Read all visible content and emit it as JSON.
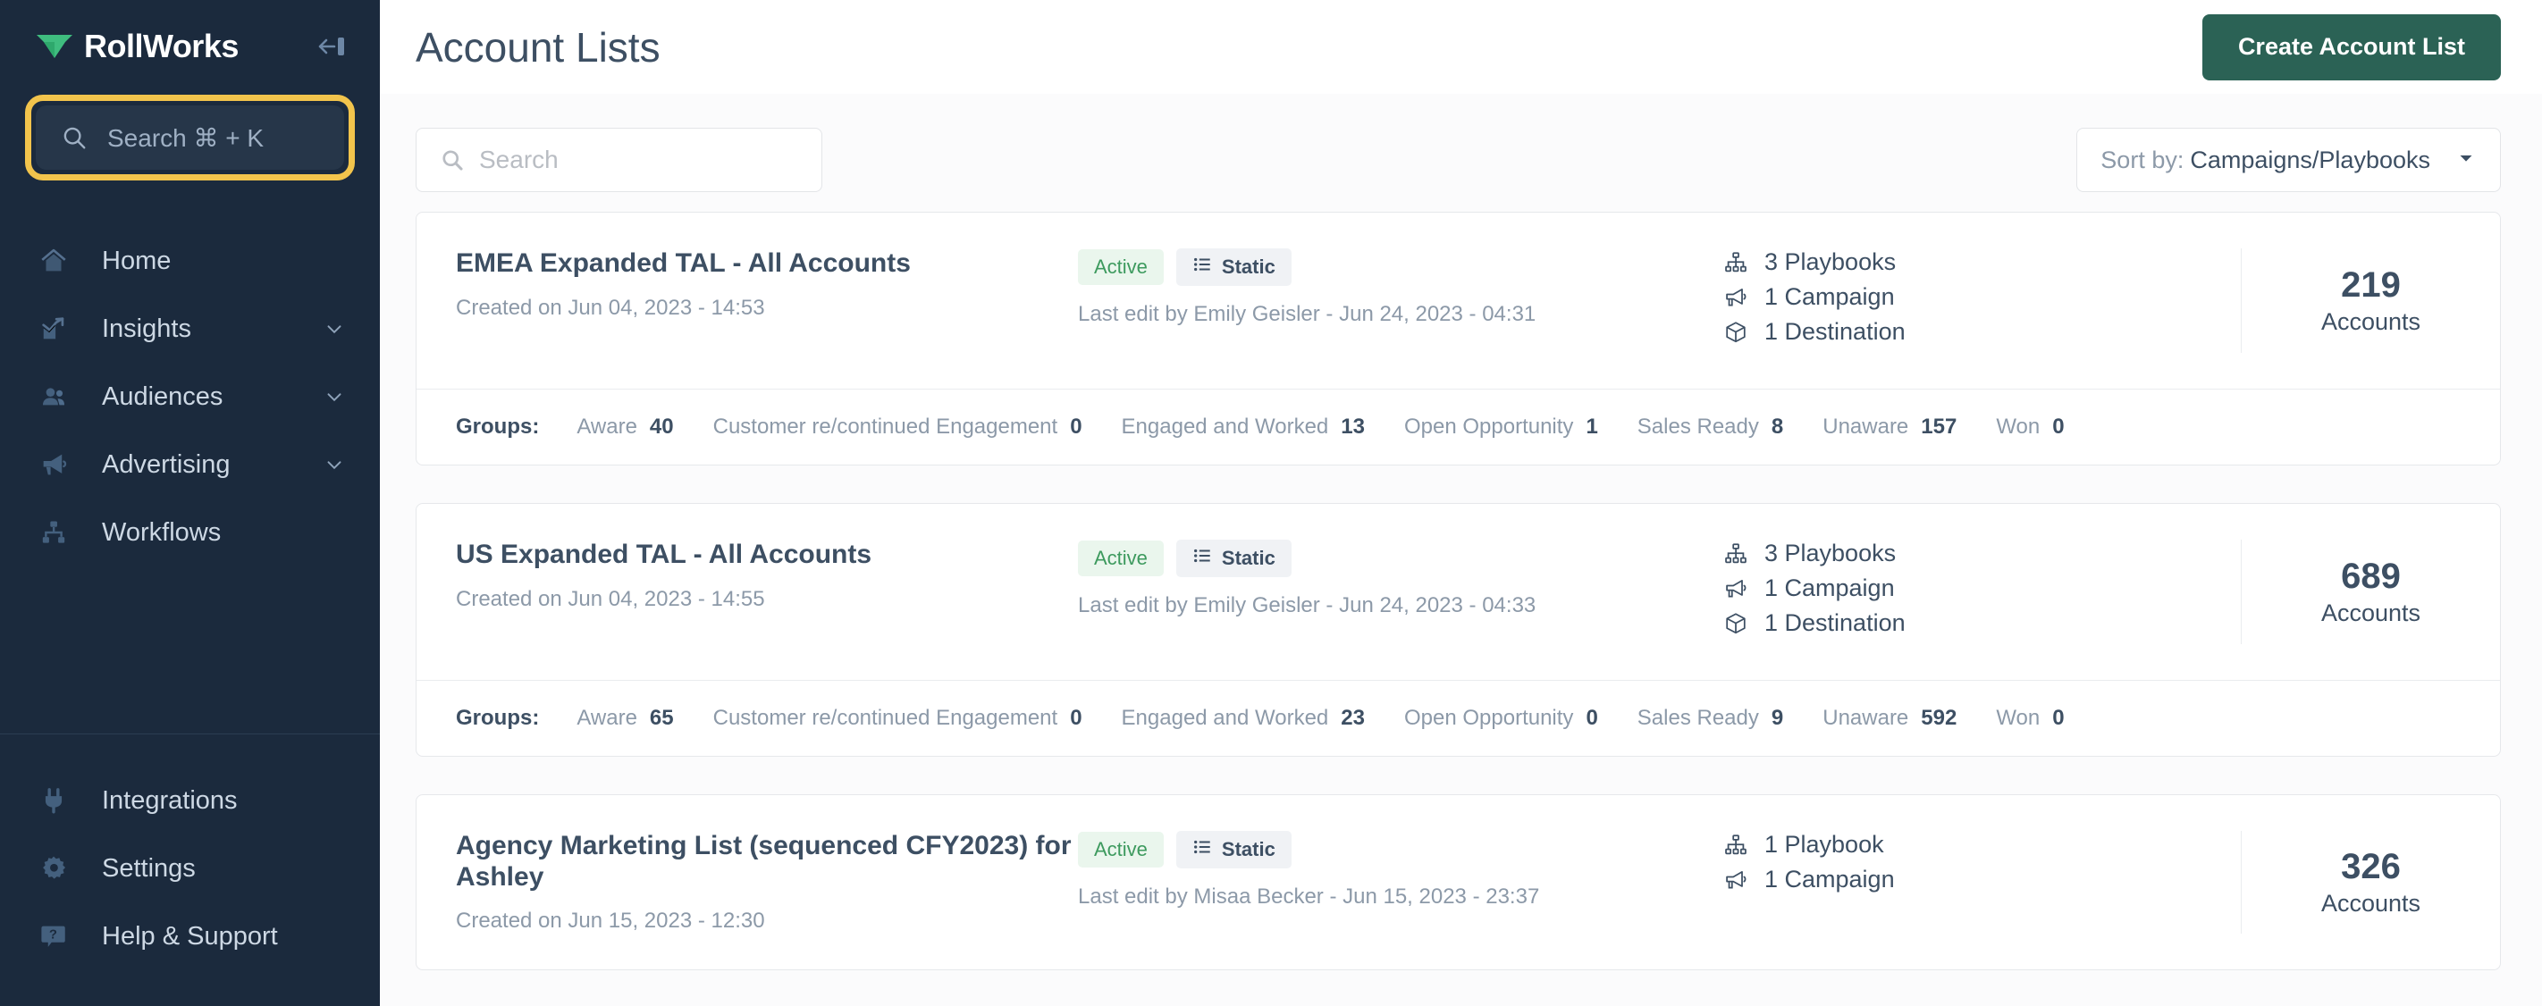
{
  "sidebar": {
    "brand": {
      "name": "RollWorks",
      "logo_icon": "rollworks-logo-icon"
    },
    "collapse_icon": "collapse-sidebar-icon",
    "search": {
      "placeholder": "Search ⌘ + K",
      "icon": "search-icon",
      "highlight_color": "#f2c44c"
    },
    "items": [
      {
        "label": "Home",
        "icon": "home-icon",
        "has_chevron": false
      },
      {
        "label": "Insights",
        "icon": "chart-up-icon",
        "has_chevron": true
      },
      {
        "label": "Audiences",
        "icon": "people-icon",
        "has_chevron": true
      },
      {
        "label": "Advertising",
        "icon": "megaphone-icon",
        "has_chevron": true
      },
      {
        "label": "Workflows",
        "icon": "sitemap-icon",
        "has_chevron": false
      }
    ],
    "bottom_items": [
      {
        "label": "Integrations",
        "icon": "plug-icon"
      },
      {
        "label": "Settings",
        "icon": "gear-icon"
      },
      {
        "label": "Help & Support",
        "icon": "help-chat-icon"
      }
    ]
  },
  "header": {
    "title": "Account Lists",
    "create_button": "Create Account List",
    "create_button_color": "#2b6255"
  },
  "toolbar": {
    "search_placeholder": "Search",
    "search_icon": "search-icon",
    "sort_label": "Sort by:",
    "sort_value": "Campaigns/Playbooks",
    "sort_chevron_icon": "chevron-down-icon"
  },
  "groups_label": "Groups:",
  "cards": [
    {
      "name": "EMEA Expanded TAL - All Accounts",
      "created": "Created on Jun 04, 2023 - 14:53",
      "status_badge": "Active",
      "type_badge": "Static",
      "type_badge_icon": "list-icon",
      "last_edit": "Last edit by Emily Geisler - Jun 24, 2023 - 04:31",
      "stats": [
        {
          "icon": "sitemap-icon",
          "text": "3 Playbooks"
        },
        {
          "icon": "megaphone-icon",
          "text": "1 Campaign"
        },
        {
          "icon": "cube-icon",
          "text": "1 Destination"
        }
      ],
      "count": "219",
      "count_label": "Accounts",
      "groups": [
        {
          "name": "Aware",
          "value": "40"
        },
        {
          "name": "Customer re/continued Engagement",
          "value": "0"
        },
        {
          "name": "Engaged and Worked",
          "value": "13"
        },
        {
          "name": "Open Opportunity",
          "value": "1"
        },
        {
          "name": "Sales Ready",
          "value": "8"
        },
        {
          "name": "Unaware",
          "value": "157"
        },
        {
          "name": "Won",
          "value": "0"
        }
      ]
    },
    {
      "name": "US Expanded TAL - All Accounts",
      "created": "Created on Jun 04, 2023 - 14:55",
      "status_badge": "Active",
      "type_badge": "Static",
      "type_badge_icon": "list-icon",
      "last_edit": "Last edit by Emily Geisler - Jun 24, 2023 - 04:33",
      "stats": [
        {
          "icon": "sitemap-icon",
          "text": "3 Playbooks"
        },
        {
          "icon": "megaphone-icon",
          "text": "1 Campaign"
        },
        {
          "icon": "cube-icon",
          "text": "1 Destination"
        }
      ],
      "count": "689",
      "count_label": "Accounts",
      "groups": [
        {
          "name": "Aware",
          "value": "65"
        },
        {
          "name": "Customer re/continued Engagement",
          "value": "0"
        },
        {
          "name": "Engaged and Worked",
          "value": "23"
        },
        {
          "name": "Open Opportunity",
          "value": "0"
        },
        {
          "name": "Sales Ready",
          "value": "9"
        },
        {
          "name": "Unaware",
          "value": "592"
        },
        {
          "name": "Won",
          "value": "0"
        }
      ]
    },
    {
      "name": "Agency Marketing List (sequenced CFY2023) for Ashley",
      "created": "Created on Jun 15, 2023 - 12:30",
      "status_badge": "Active",
      "type_badge": "Static",
      "type_badge_icon": "list-icon",
      "last_edit": "Last edit by Misaa Becker - Jun 15, 2023 - 23:37",
      "stats": [
        {
          "icon": "sitemap-icon",
          "text": "1 Playbook"
        },
        {
          "icon": "megaphone-icon",
          "text": "1 Campaign"
        }
      ],
      "count": "326",
      "count_label": "Accounts",
      "groups": []
    }
  ]
}
